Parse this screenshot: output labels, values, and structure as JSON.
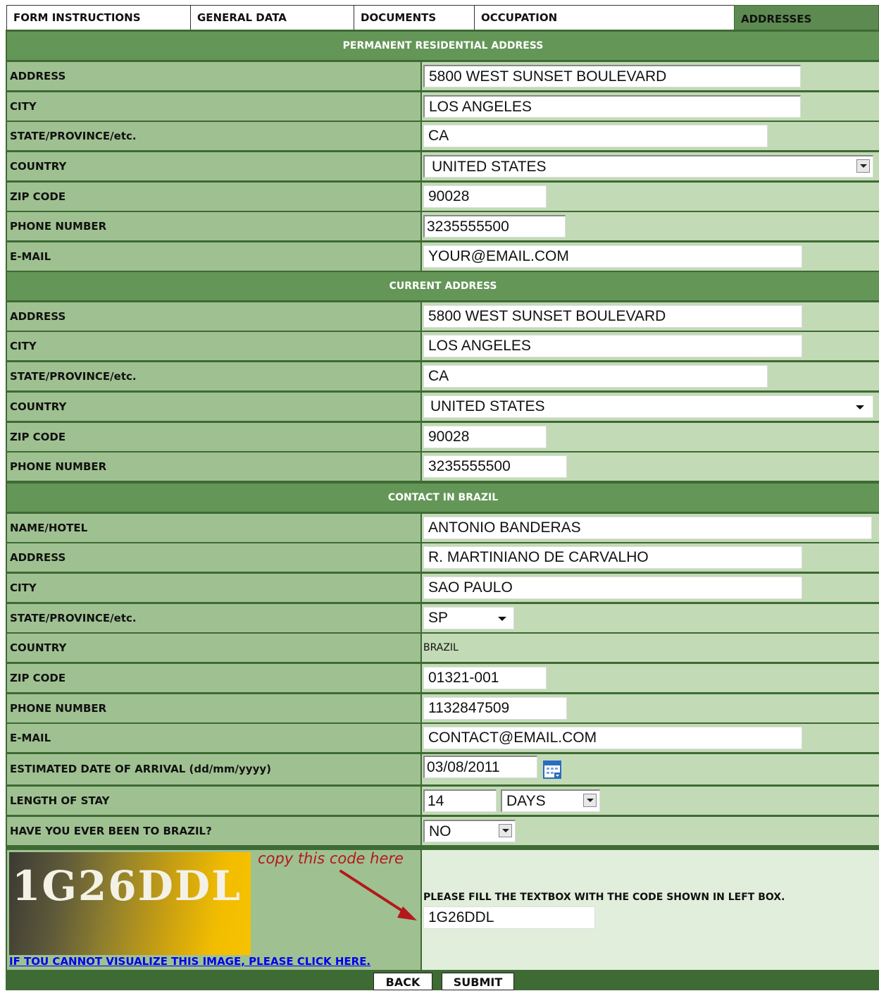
{
  "tabs": [
    {
      "label": "FORM INSTRUCTIONS"
    },
    {
      "label": "GENERAL DATA"
    },
    {
      "label": "DOCUMENTS"
    },
    {
      "label": "OCCUPATION"
    },
    {
      "label": "ADDRESSES",
      "active": true
    }
  ],
  "permanent": {
    "title": "PERMANENT RESIDENTIAL ADDRESS",
    "rows": [
      {
        "label": "ADDRESS",
        "value": "5800 WEST SUNSET BOULEVARD"
      },
      {
        "label": "CITY",
        "value": "LOS ANGELES"
      },
      {
        "label": "STATE/PROVINCE/etc.",
        "value": "CA"
      },
      {
        "label": "COUNTRY",
        "value": "UNITED STATES"
      },
      {
        "label": "ZIP CODE",
        "value": "90028"
      },
      {
        "label": "PHONE NUMBER",
        "value": "3235555500"
      },
      {
        "label": "E-MAIL",
        "value": "YOUR@EMAIL.COM"
      }
    ]
  },
  "current": {
    "title": "CURRENT ADDRESS",
    "rows": [
      {
        "label": "ADDRESS",
        "value": "5800 WEST SUNSET BOULEVARD"
      },
      {
        "label": "CITY",
        "value": "LOS ANGELES"
      },
      {
        "label": "STATE/PROVINCE/etc.",
        "value": "CA"
      },
      {
        "label": "COUNTRY",
        "value": "UNITED STATES"
      },
      {
        "label": "ZIP CODE",
        "value": "90028"
      },
      {
        "label": "PHONE NUMBER",
        "value": "3235555500"
      }
    ]
  },
  "brazil": {
    "title": "CONTACT IN BRAZIL",
    "rows": [
      {
        "label": "NAME/HOTEL",
        "value": "ANTONIO BANDERAS"
      },
      {
        "label": "ADDRESS",
        "value": "R. MARTINIANO DE CARVALHO"
      },
      {
        "label": "CITY",
        "value": "SAO PAULO"
      },
      {
        "label": "STATE/PROVINCE/etc.",
        "value": "SP"
      },
      {
        "label": "COUNTRY",
        "value": "BRAZIL"
      },
      {
        "label": "ZIP CODE",
        "value": "01321-001"
      },
      {
        "label": "PHONE NUMBER",
        "value": "1132847509"
      },
      {
        "label": "E-MAIL",
        "value": "CONTACT@EMAIL.COM"
      },
      {
        "label": "ESTIMATED DATE OF ARRIVAL (dd/mm/yyyy)",
        "value": "03/08/2011"
      },
      {
        "label": "LENGTH OF STAY",
        "value": "14",
        "unit": "DAYS"
      },
      {
        "label": "HAVE YOU EVER BEEN TO BRAZIL?",
        "value": "NO"
      }
    ]
  },
  "captcha": {
    "image_code": "1G26DDL",
    "hint": "copy this code here",
    "help_link": "IF TOU CANNOT VISUALIZE THIS IMAGE, PLEASE CLICK HERE.",
    "instruction": "PLEASE FILL THE TEXTBOX WITH THE CODE SHOWN IN LEFT BOX.",
    "input_value": "1G26DDL"
  },
  "buttons": {
    "back": "BACK",
    "submit": "SUBMIT"
  }
}
